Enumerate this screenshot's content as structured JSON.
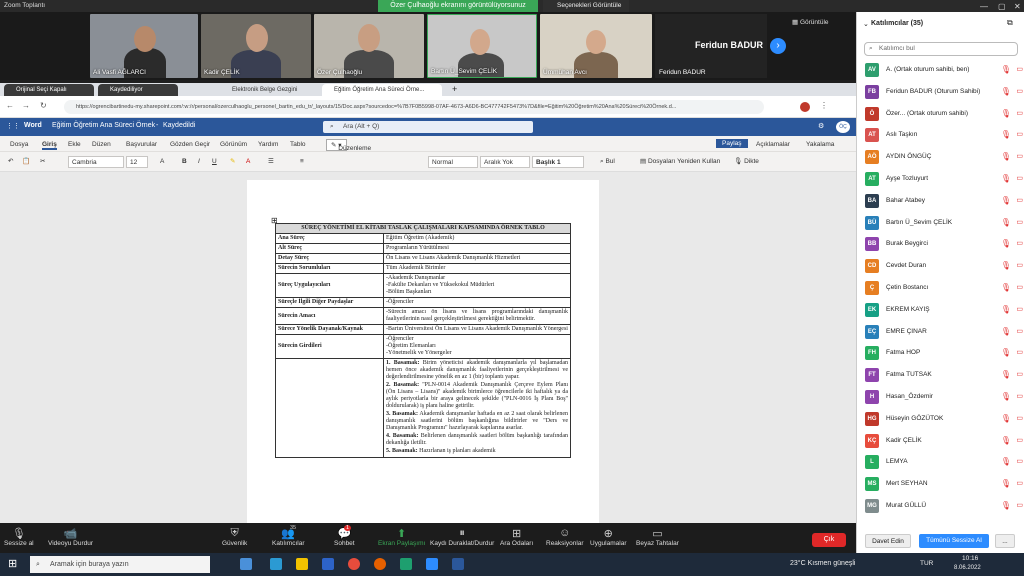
{
  "zoom": {
    "title": "Zoom Toplantı",
    "sharing_banner": "Özer Çulhaoğlu ekranını görüntülüyorsunuz",
    "view_options": "Seçenekleri Görüntüle",
    "gallery": "Görüntüle"
  },
  "video": [
    {
      "name": "Ali Vasfi AĞLARCI"
    },
    {
      "name": "Kadir ÇELİK"
    },
    {
      "name": "Özer Çulhaoğlu"
    },
    {
      "name": "Bartın Ü_Sevim ÇELİK"
    },
    {
      "name": "Ümmühan Avcı"
    }
  ],
  "feridun": {
    "big": "Feridun BADUR",
    "small": "Feridun BADUR"
  },
  "browser": {
    "tabs": [
      {
        "label": "Orijinal Seçi Kapalı"
      },
      {
        "label": "Kaydediliyor"
      },
      {
        "label": "Elektronik Belge Gezgini"
      },
      {
        "label": "Eğitim Öğretim Ana Süreci Örne..."
      }
    ],
    "url": "https://ogrencibartinedu-my.sharepoint.com/:w:/r/personal/ozerculhaoglu_personel_bartin_edu_tr/_layouts/15/Doc.aspx?sourcedoc=%7B7F0B5998-07AF-4673-A6D6-BC477742F5473%7D&file=Eğitim%20Öğretim%20Ana%20Süreci%20Örnek.d..."
  },
  "word": {
    "app": "Word",
    "doc_title": "Eğitim Öğretim Ana Süreci Örnek",
    "saved": "Kaydedildi",
    "search": "Ara (Alt + Q)",
    "ribbon_tabs": [
      "Dosya",
      "Giriş",
      "Ekle",
      "Düzen",
      "Başvurular",
      "Gözden Geçir",
      "Görünüm",
      "Yardım",
      "Tablo"
    ],
    "editing": "Düzenleme",
    "share": "Paylaş",
    "comments": "Açıklamalar",
    "catchup": "Yakalama",
    "font": "Cambria",
    "size": "12",
    "styles": [
      "Normal",
      "Aralık Yok",
      "Başlık 1"
    ],
    "find": "Bul",
    "reuse": "Dosyaları Yeniden Kullan",
    "dictate": "Dikte"
  },
  "table": {
    "title": "SÜREÇ YÖNETİMİ EL KİTABI TASLAK ÇALIŞMALARI KAPSAMINDA ÖRNEK TABLO",
    "rows": [
      {
        "k": "Ana Süreç",
        "v": "Eğitim Öğretim (Akademik)"
      },
      {
        "k": "Alt Süreç",
        "v": "Programların Yürütülmesi"
      },
      {
        "k": "Detay Süreç",
        "v": "Ön Lisans ve Lisans Akademik Danışmanlık Hizmetleri"
      },
      {
        "k": "Sürecin Sorumluları",
        "v": "Tüm Akademik Birimler"
      },
      {
        "k": "Süreç Uygulayıcıları",
        "v": "-Akademik Danışmanlar\n-Fakülte Dekanları ve Yüksekokul Müdürleri\n-Bölüm Başkanları"
      },
      {
        "k": "Süreçle İlgili Diğer Paydaşlar",
        "v": "-Öğrenciler"
      },
      {
        "k": "Sürecin Amacı",
        "v": "-Sürecin amacı ön lisans ve lisans programlarındaki danışmanlık faaliyetlerinin nasıl gerçekleştirilmesi gerektiğini belirtmektir."
      },
      {
        "k": "Sürece Yönelik Dayanak/Kaynak",
        "v": "-Bartın Üniversitesi Ön Lisans ve Lisans Akademik Danışmanlık Yönergesi"
      },
      {
        "k": "Sürecin Girdileri",
        "v": "-Öğrenciler\n-Öğretim Elemanları\n-Yönetmelik ve Yönergeler"
      }
    ],
    "steps": [
      {
        "b": "1. Basamak:",
        "t": " Birim yöneticisi akademik danışmanlarla yıl başlamadan hemen önce akademik danışmanlık faaliyetlerinin gerçekleştirilmesi ve değerlendirilmesine yönelik en az 1 (bir) toplantı yapar."
      },
      {
        "b": "2. Basamak:",
        "t": " \"PLN-0014 Akademik Danışmanlık Çerçeve Eylem Planı (Ön Lisans – Lisans)\" akademik birimlerce öğrencilerle iki haftalık ya da aylık periyotlarla bir araya gelinecek şekilde (\"PLN-0016 İş Planı Boş\" doldurularak) iş planı haline getirilir."
      },
      {
        "b": "3. Basamak:",
        "t": " Akademik danışmanlar haftada en az 2 saat olarak belirlenen danışmanlık saatlerini bölüm başkanlığına bildirirler ve \"Ders ve Danışmanlık Programını\" hazırlayarak kapılarına asarlar."
      },
      {
        "b": "4. Basamak:",
        "t": " Belirlenen danışmanlık saatleri bölüm başkanlığı tarafından dekanlığa iletilir."
      },
      {
        "b": "5. Basamak:",
        "t": " Hazırlanan iş planları akademik"
      }
    ]
  },
  "participants": {
    "title": "Katılımcılar (35)",
    "search": "Katılımcı bul",
    "list": [
      {
        "ini": "AV",
        "name": "A. (Ortak oturum sahibi, ben)",
        "color": "#2e9e6e"
      },
      {
        "ini": "FB",
        "name": "Feridun BADUR (Oturum Sahibi)",
        "color": "#7b3fa0"
      },
      {
        "ini": "Ö",
        "name": "Özer... (Ortak oturum sahibi)",
        "color": "#c0392b"
      },
      {
        "ini": "AT",
        "name": "Aslı Taşkın",
        "color": "#d9534f"
      },
      {
        "ini": "AÖ",
        "name": "AYDIN ÖNGÜÇ",
        "color": "#e67e22"
      },
      {
        "ini": "AT",
        "name": "Ayşe Tozluyurt",
        "color": "#27ae60"
      },
      {
        "ini": "BA",
        "name": "Bahar Atabey",
        "color": "#2c3e50"
      },
      {
        "ini": "BÜ",
        "name": "Bartın Ü_Sevim ÇELİK",
        "color": "#2980b9"
      },
      {
        "ini": "BB",
        "name": "Burak Beygirci",
        "color": "#8e44ad"
      },
      {
        "ini": "CD",
        "name": "Cevdet Duran",
        "color": "#e67e22"
      },
      {
        "ini": "Ç",
        "name": "Çetin Bostancı",
        "color": "#e67e22"
      },
      {
        "ini": "EK",
        "name": "EKREM KAYIŞ",
        "color": "#16a085"
      },
      {
        "ini": "EÇ",
        "name": "EMRE ÇINAR",
        "color": "#2980b9"
      },
      {
        "ini": "FH",
        "name": "Fatma HOP",
        "color": "#27ae60"
      },
      {
        "ini": "FT",
        "name": "Fatma TUTSAK",
        "color": "#8e44ad"
      },
      {
        "ini": "H",
        "name": "Hasan_Özdemir",
        "color": "#8e44ad"
      },
      {
        "ini": "HG",
        "name": "Hüseyin GÖZÜTOK",
        "color": "#c0392b"
      },
      {
        "ini": "KÇ",
        "name": "Kadir ÇELİK",
        "color": "#e74c3c"
      },
      {
        "ini": "L",
        "name": "LEMYA",
        "color": "#27ae60"
      },
      {
        "ini": "MS",
        "name": "Mert SEYHAN",
        "color": "#27ae60"
      },
      {
        "ini": "MG",
        "name": "Murat GÜLLÜ",
        "color": "#7f8c8d"
      }
    ],
    "invite": "Davet Edin",
    "mute_all": "Tümünü Sessize Al",
    "more": "..."
  },
  "toolbar": {
    "items": [
      {
        "icon": "microphone-icon",
        "glyph": "🎙",
        "label": "Sessize al"
      },
      {
        "icon": "video-icon",
        "glyph": "📹",
        "label": "Videoyu Durdur"
      },
      {
        "icon": "shield-icon",
        "glyph": "⛨",
        "label": "Güvenlik"
      },
      {
        "icon": "participants-icon",
        "glyph": "👥",
        "label": "Katılımcılar",
        "badge": "35"
      },
      {
        "icon": "chat-icon",
        "glyph": "💬",
        "label": "Sohbet",
        "badge": "1"
      },
      {
        "icon": "share-screen-icon",
        "glyph": "⬆",
        "label": "Ekran Paylaşımı"
      },
      {
        "icon": "record-icon",
        "glyph": "⏸",
        "label": "Kaydı Duraklat/Durdur"
      },
      {
        "icon": "breakout-rooms-icon",
        "glyph": "⊞",
        "label": "Ara Odaları"
      },
      {
        "icon": "reactions-icon",
        "glyph": "☺",
        "label": "Reaksiyonlar"
      },
      {
        "icon": "apps-icon",
        "glyph": "⊕",
        "label": "Uygulamalar"
      },
      {
        "icon": "whiteboard-icon",
        "glyph": "▭",
        "label": "Beyaz Tahtalar"
      }
    ],
    "leave": "Çık"
  },
  "taskbar": {
    "search": "Aramak için buraya yazın",
    "weather": "23°C Kısmen güneşli",
    "lang": "TUR",
    "time": "10:16",
    "date": "8.06.2022"
  }
}
